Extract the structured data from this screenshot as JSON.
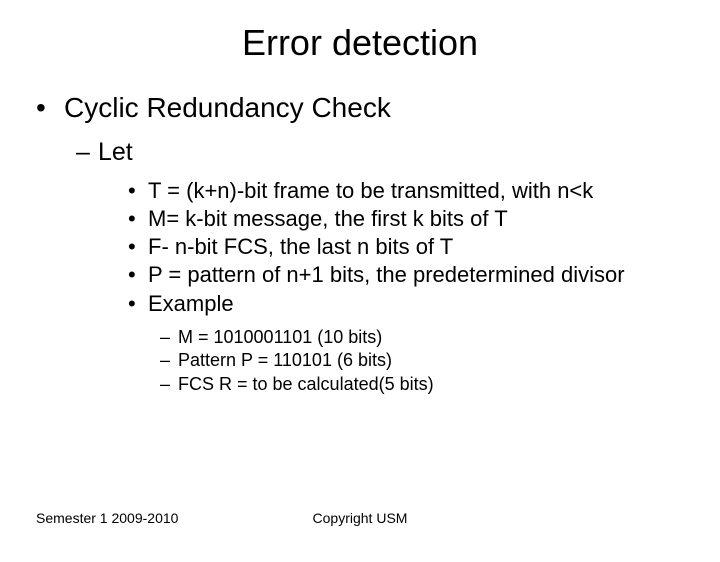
{
  "title": "Error detection",
  "h1": "Cyclic Redundancy Check",
  "h2": "Let",
  "items": [
    "T = (k+n)-bit frame to be transmitted, with n<k",
    "M= k-bit message, the first k bits of T",
    "F- n-bit FCS, the last n bits of T",
    "P = pattern of n+1 bits, the predetermined divisor",
    "Example"
  ],
  "example": [
    "M = 1010001101 (10 bits)",
    "Pattern P = 110101 (6 bits)",
    "FCS R = to be calculated(5 bits)"
  ],
  "footer_left": "Semester 1 2009-2010",
  "footer_center": "Copyright USM"
}
